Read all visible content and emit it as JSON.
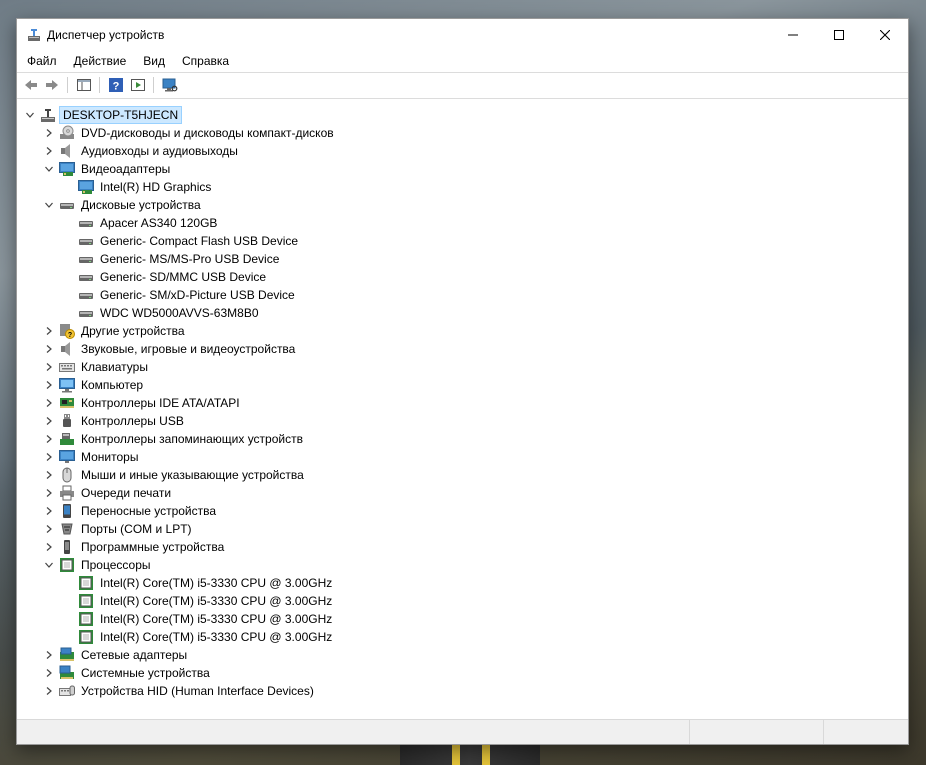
{
  "window": {
    "title": "Диспетчер устройств"
  },
  "menu": [
    "Файл",
    "Действие",
    "Вид",
    "Справка"
  ],
  "toolbar_icons": [
    "back-arrow-icon",
    "forward-arrow-icon",
    "properties-pane-icon",
    "help-icon",
    "run-icon",
    "monitor-scan-icon"
  ],
  "tree": {
    "root": "DESKTOP-T5HJECN",
    "items": [
      {
        "label": "DVD-дисководы и дисководы компакт-дисков",
        "level": 1,
        "expanded": false,
        "icon": "dvd-icon"
      },
      {
        "label": "Аудиовходы и аудиовыходы",
        "level": 1,
        "expanded": false,
        "icon": "speaker-icon"
      },
      {
        "label": "Видеоадаптеры",
        "level": 1,
        "expanded": true,
        "icon": "display-adapter-icon"
      },
      {
        "label": "Intel(R) HD Graphics",
        "level": 2,
        "icon": "display-adapter-icon"
      },
      {
        "label": "Дисковые устройства",
        "level": 1,
        "expanded": true,
        "icon": "disk-icon"
      },
      {
        "label": "Apacer AS340 120GB",
        "level": 2,
        "icon": "disk-icon"
      },
      {
        "label": "Generic- Compact Flash USB Device",
        "level": 2,
        "icon": "disk-icon"
      },
      {
        "label": "Generic- MS/MS-Pro USB Device",
        "level": 2,
        "icon": "disk-icon"
      },
      {
        "label": "Generic- SD/MMC USB Device",
        "level": 2,
        "icon": "disk-icon"
      },
      {
        "label": "Generic- SM/xD-Picture USB Device",
        "level": 2,
        "icon": "disk-icon"
      },
      {
        "label": "WDC WD5000AVVS-63M8B0",
        "level": 2,
        "icon": "disk-icon"
      },
      {
        "label": "Другие устройства",
        "level": 1,
        "expanded": false,
        "icon": "unknown-device-icon"
      },
      {
        "label": "Звуковые, игровые и видеоустройства",
        "level": 1,
        "expanded": false,
        "icon": "speaker-icon"
      },
      {
        "label": "Клавиатуры",
        "level": 1,
        "expanded": false,
        "icon": "keyboard-icon"
      },
      {
        "label": "Компьютер",
        "level": 1,
        "expanded": false,
        "icon": "computer-icon"
      },
      {
        "label": "Контроллеры IDE ATA/ATAPI",
        "level": 1,
        "expanded": false,
        "icon": "ide-controller-icon"
      },
      {
        "label": "Контроллеры USB",
        "level": 1,
        "expanded": false,
        "icon": "usb-icon"
      },
      {
        "label": "Контроллеры запоминающих устройств",
        "level": 1,
        "expanded": false,
        "icon": "storage-controller-icon"
      },
      {
        "label": "Мониторы",
        "level": 1,
        "expanded": false,
        "icon": "monitor-icon"
      },
      {
        "label": "Мыши и иные указывающие устройства",
        "level": 1,
        "expanded": false,
        "icon": "mouse-icon"
      },
      {
        "label": "Очереди печати",
        "level": 1,
        "expanded": false,
        "icon": "printer-icon"
      },
      {
        "label": "Переносные устройства",
        "level": 1,
        "expanded": false,
        "icon": "portable-device-icon"
      },
      {
        "label": "Порты (COM и LPT)",
        "level": 1,
        "expanded": false,
        "icon": "port-icon"
      },
      {
        "label": "Программные устройства",
        "level": 1,
        "expanded": false,
        "icon": "software-device-icon"
      },
      {
        "label": "Процессоры",
        "level": 1,
        "expanded": true,
        "icon": "processor-icon"
      },
      {
        "label": "Intel(R) Core(TM) i5-3330 CPU @ 3.00GHz",
        "level": 2,
        "icon": "processor-icon"
      },
      {
        "label": "Intel(R) Core(TM) i5-3330 CPU @ 3.00GHz",
        "level": 2,
        "icon": "processor-icon"
      },
      {
        "label": "Intel(R) Core(TM) i5-3330 CPU @ 3.00GHz",
        "level": 2,
        "icon": "processor-icon"
      },
      {
        "label": "Intel(R) Core(TM) i5-3330 CPU @ 3.00GHz",
        "level": 2,
        "icon": "processor-icon"
      },
      {
        "label": "Сетевые адаптеры",
        "level": 1,
        "expanded": false,
        "icon": "network-adapter-icon"
      },
      {
        "label": "Системные устройства",
        "level": 1,
        "expanded": false,
        "icon": "system-device-icon"
      },
      {
        "label": "Устройства HID (Human Interface Devices)",
        "level": 1,
        "expanded": false,
        "icon": "hid-icon"
      }
    ]
  },
  "colors": {
    "selection_bg": "#cce8ff",
    "selection_border": "#99d1ff"
  }
}
